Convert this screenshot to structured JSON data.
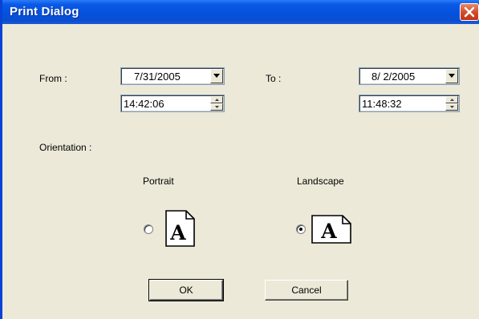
{
  "window": {
    "title": "Print Dialog"
  },
  "from": {
    "label": "From :",
    "date": "7/31/2005",
    "time": "14:42:06"
  },
  "to": {
    "label": "To :",
    "date": "8/ 2/2005",
    "time": "11:48:32"
  },
  "orientation": {
    "label": "Orientation :",
    "portrait": {
      "label": "Portrait",
      "selected": false,
      "glyph": "A"
    },
    "landscape": {
      "label": "Landscape",
      "selected": true,
      "glyph": "A"
    }
  },
  "buttons": {
    "ok": "OK",
    "cancel": "Cancel"
  },
  "colors": {
    "titlebar": "#0451dd",
    "close": "#d1492a",
    "face": "#ece9d8"
  }
}
